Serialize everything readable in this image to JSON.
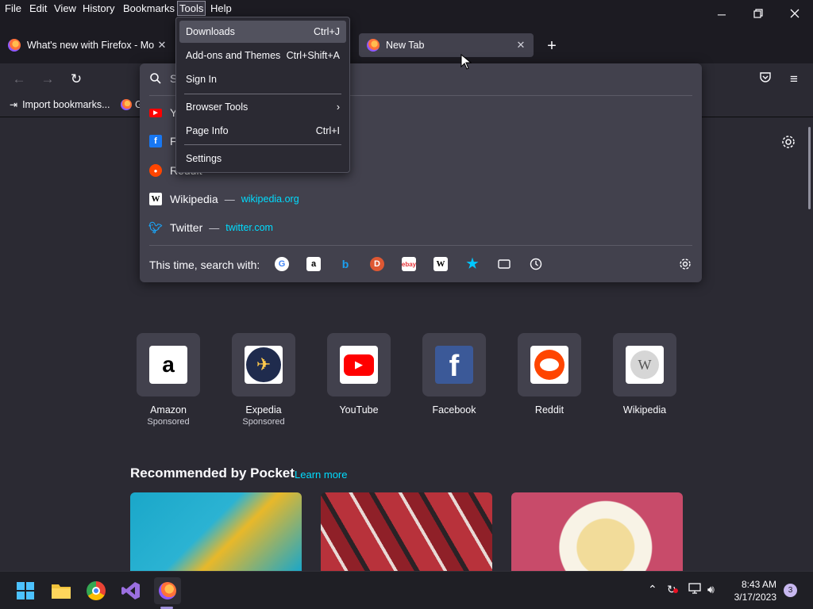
{
  "menubar": {
    "items": [
      "File",
      "Edit",
      "View",
      "History",
      "Bookmarks",
      "Tools",
      "Help"
    ],
    "active": "Tools"
  },
  "window_controls": [
    "minimize-icon",
    "restore-icon",
    "close-icon"
  ],
  "tabs": [
    {
      "title": "What's new with Firefox - More",
      "selected": false
    },
    {
      "title": "New Tab",
      "selected": true
    }
  ],
  "bookmarks": {
    "import_label": "Import bookmarks...",
    "second_label": "G"
  },
  "tools_menu": {
    "items": [
      {
        "label": "Downloads",
        "shortcut": "Ctrl+J"
      },
      {
        "label": "Add-ons and Themes",
        "shortcut": "Ctrl+Shift+A"
      },
      {
        "label": "Sign In",
        "shortcut": ""
      },
      {
        "label": "Browser Tools",
        "shortcut": ""
      },
      {
        "label": "Page Info",
        "shortcut": "Ctrl+I"
      },
      {
        "label": "Settings",
        "shortcut": ""
      }
    ]
  },
  "url_panel": {
    "search_placeholder": "S",
    "suggestions": [
      {
        "name": "Y",
        "url": ""
      },
      {
        "name": "F",
        "url": ""
      },
      {
        "name": "Reddit",
        "url": ""
      },
      {
        "name": "Wikipedia",
        "url": "wikipedia.org"
      },
      {
        "name": "Twitter",
        "url": "twitter.com"
      }
    ],
    "search_with_label": "This time, search with:"
  },
  "shortcuts": [
    {
      "name": "Amazon",
      "sponsored": "Sponsored"
    },
    {
      "name": "Expedia",
      "sponsored": "Sponsored"
    },
    {
      "name": "YouTube",
      "sponsored": ""
    },
    {
      "name": "Facebook",
      "sponsored": ""
    },
    {
      "name": "Reddit",
      "sponsored": ""
    },
    {
      "name": "Wikipedia",
      "sponsored": ""
    }
  ],
  "pocket": {
    "heading": "Recommended by Pocket",
    "learn_more": "Learn more"
  },
  "taskbar": {
    "time": "8:43 AM",
    "date": "3/17/2023",
    "notifications": "3"
  },
  "colors": {
    "accent": "#00ddff",
    "background": "#1c1b22",
    "panel": "#42414d"
  }
}
